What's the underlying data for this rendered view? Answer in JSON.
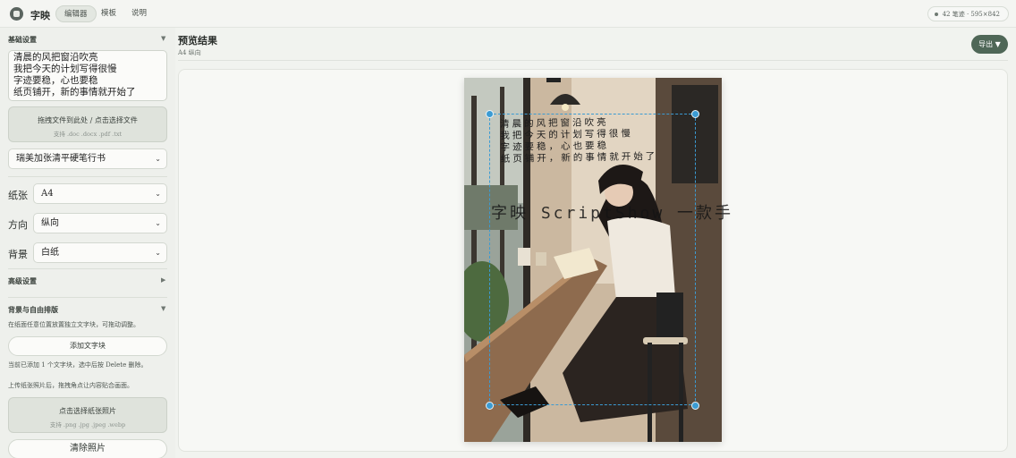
{
  "app": {
    "name": "字映"
  },
  "nav": {
    "tabs": [
      {
        "label": "编辑器",
        "active": true
      },
      {
        "label": "模板"
      },
      {
        "label": "说明"
      }
    ]
  },
  "header_stat": "42 笔迹 · 595×842",
  "sidebar": {
    "basic_title": "基础设置",
    "text_lines": "清晨的风把窗沿吹亮\n我把今天的计划写得很慢\n字迹要稳，心也要稳\n纸页铺开，新的事情就开始了",
    "upload": {
      "title": "拖拽文件到此处 / 点击选择文件",
      "sub": "支持 .doc .docx .pdf .txt"
    },
    "font_select": "瑞美加张清平硬笔行书",
    "paper_label": "纸张",
    "paper_value": "A4",
    "orientation_label": "方向",
    "orientation_value": "纵向",
    "background_label": "背景",
    "background_value": "白纸",
    "advanced_title": "高级设置",
    "freeform_title": "背景与自由排版",
    "freeform_hint": "在纸面任意位置放置独立文字块，可拖动调整。",
    "add_block_label": "添加文字块",
    "block_count_hint": "当前已添加 1 个文字块，选中后按 Delete 删除。",
    "photo_hint": "上传纸张照片后，拖拽角点让内容贴合画面。",
    "photo_upload": {
      "title": "点击选择纸张照片",
      "sub": "支持 .png .jpg .jpeg .webp"
    },
    "clear_photo_label": "清除照片"
  },
  "main": {
    "title": "预览结果",
    "subtitle": "A4 纵向",
    "export_label": "导出 ▼",
    "handwriting_text": "清晨的风把窗沿吹亮\n我把今天的计划写得很慢\n字迹要稳，心也要稳\n纸页铺开，新的事情就开始了",
    "watermark_text": "字映 ScriptShow 一款手"
  },
  "icons": {
    "logo": "app-logo-icon",
    "caret_down": "caret-down-icon",
    "caret_right": "caret-right-icon",
    "chevron": "chevron-down-icon"
  },
  "colors": {
    "accent": "#4f6757",
    "selection": "#3b9bd3"
  }
}
